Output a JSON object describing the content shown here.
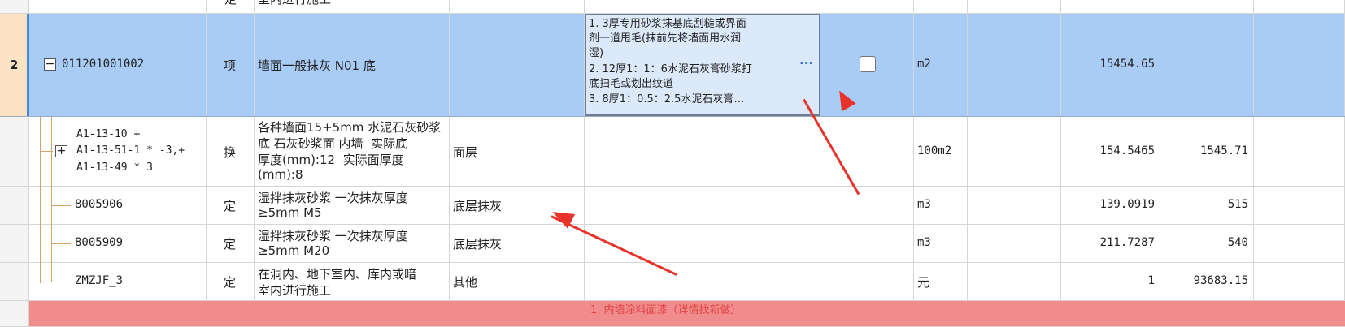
{
  "rows": [
    {
      "id": "top-partial",
      "code": "",
      "type": "定",
      "name": "室内进行施工",
      "feature": "",
      "unit": "",
      "qty": "",
      "price": ""
    },
    {
      "id": "row-2",
      "index": "2",
      "code": "011201001002",
      "type": "项",
      "name": "墙面一般抹灰 N01 底",
      "features": [
        "1. 3厚专用砂浆抹基底刮糙或界面",
        "剂一道甩毛(抹前先将墙面用水润",
        "湿)",
        "2. 12厚1：1：6水泥石灰膏砂浆打",
        "底扫毛或划出纹道",
        "3. 8厚1：0.5：2.5水泥石灰膏…"
      ],
      "more": "···",
      "unit": "m2",
      "qty": "15454.65"
    },
    {
      "id": "row-a1",
      "code_lines": [
        "A1-13-10 +",
        "A1-13-51-1 * -3,+",
        "A1-13-49 * 3"
      ],
      "type": "换",
      "name_lines": [
        "各种墙面15+5mm 水泥石灰砂浆",
        "底 石灰砂浆面 内墙  实际底",
        "厚度(mm):12  实际面厚度",
        "(mm):8"
      ],
      "layer": "面层",
      "unit": "100m2",
      "qty": "154.5465",
      "price": "1545.71"
    },
    {
      "id": "row-8005906",
      "code": "8005906",
      "type": "定",
      "name_lines": [
        "湿拌抹灰砂浆 一次抹灰厚度",
        "≥5mm M5"
      ],
      "layer": "底层抹灰",
      "unit": "m3",
      "qty": "139.0919",
      "price": "515"
    },
    {
      "id": "row-8005909",
      "code": "8005909",
      "type": "定",
      "name_lines": [
        "湿拌抹灰砂浆 一次抹灰厚度",
        "≥5mm M20"
      ],
      "layer": "底层抹灰",
      "unit": "m3",
      "qty": "211.7287",
      "price": "540"
    },
    {
      "id": "row-zmzjf",
      "code": "ZMZJF_3",
      "type": "定",
      "name_lines": [
        "在洞内、地下室内、库内或暗",
        "室内进行施工"
      ],
      "layer": "其他",
      "unit": "元",
      "qty": "1",
      "price": "93683.15"
    },
    {
      "id": "bottom-partial",
      "feature": "1. 内墙涂料面漆（详情找新做）"
    }
  ],
  "colors": {
    "selected_row": "#a8ccf5",
    "selected_rownum": "#fbe3c4",
    "arrow": "#e8332a",
    "bottom_row": "#f08c8c",
    "tree_line": "#d2a26a"
  }
}
